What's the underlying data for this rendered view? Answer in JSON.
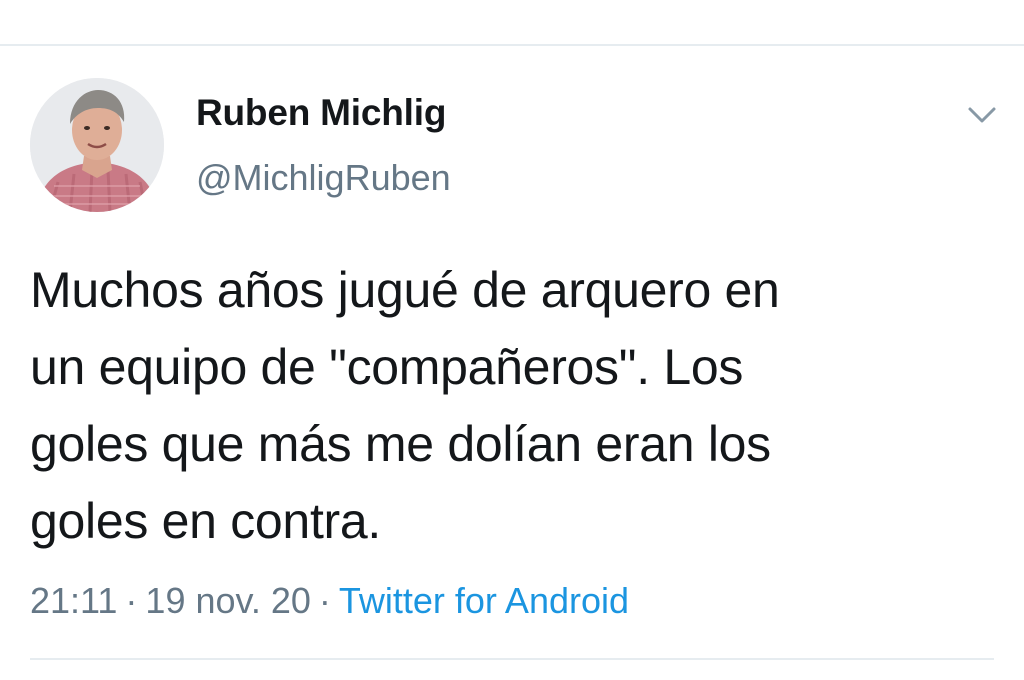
{
  "tweet": {
    "author": {
      "display_name": "Ruben Michlig",
      "handle": "@MichligRuben"
    },
    "text": "Muchos años jugué de arquero en\nun equipo de \"compañeros\". Los\ngoles que más me dolían eran los\ngoles en contra.",
    "meta": {
      "time": "21:11",
      "separator": "·",
      "date": "19 nov. 20",
      "source": "Twitter for Android"
    },
    "menu_icon": "chevron-down-icon"
  },
  "colors": {
    "text": "#14171a",
    "secondary_text": "#657786",
    "link": "#1b95e0",
    "divider": "#e6ecf0"
  }
}
